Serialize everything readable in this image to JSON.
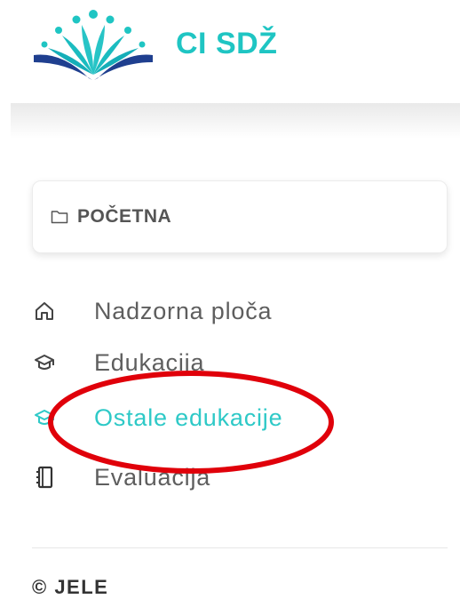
{
  "brand": {
    "name": "CI SDŽ",
    "color": "#1fc5c3"
  },
  "home_card": {
    "label": "POČETNA",
    "icon": "folder-icon"
  },
  "menu": {
    "items": [
      {
        "label": "Nadzorna ploča",
        "icon": "home-icon",
        "active": false
      },
      {
        "label": "Edukacija",
        "icon": "graduation-cap-icon",
        "active": false
      },
      {
        "label": "Ostale edukacije",
        "icon": "graduation-cap-icon",
        "active": true
      },
      {
        "label": "Evaluacija",
        "icon": "notebook-icon",
        "active": false
      }
    ]
  },
  "footer": {
    "text": "© JELE"
  },
  "colors": {
    "accent": "#2ec9c7",
    "text": "#5e5e5e",
    "annotation": "#e0000a"
  }
}
